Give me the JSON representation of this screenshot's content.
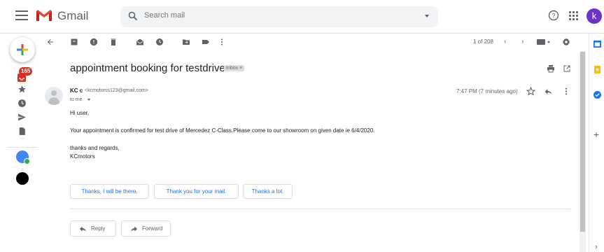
{
  "app": {
    "name": "Gmail",
    "account_initial": "k",
    "accent_color": "#1a73e8",
    "brand_red": "#ea4335"
  },
  "search": {
    "placeholder": "Search mail",
    "icon": "search-icon"
  },
  "nav": {
    "inbox_unread_count": "165"
  },
  "toolbar": {
    "page_count": "1 of 208"
  },
  "message": {
    "subject": "appointment booking for testdrive",
    "label": "Inbox ×",
    "sender_name": "KC c",
    "sender_email": "<kcmotorss123@gmail.com>",
    "recipient": "to me",
    "timestamp": "7:47 PM (7 minutes ago)",
    "greeting": "Hi user,",
    "body": "Your appointment is confirmed for test drive of Mercedez C-Class.Please come to our showroom on given date ie 6/4/2020.",
    "closing": "thanks and regards,",
    "signature": "KCmotors"
  },
  "smart_replies": [
    "Thanks, I will be there.",
    "Thank you for your mail.",
    "Thanks a lot."
  ],
  "actions": {
    "reply": "Reply",
    "forward": "Forward"
  }
}
